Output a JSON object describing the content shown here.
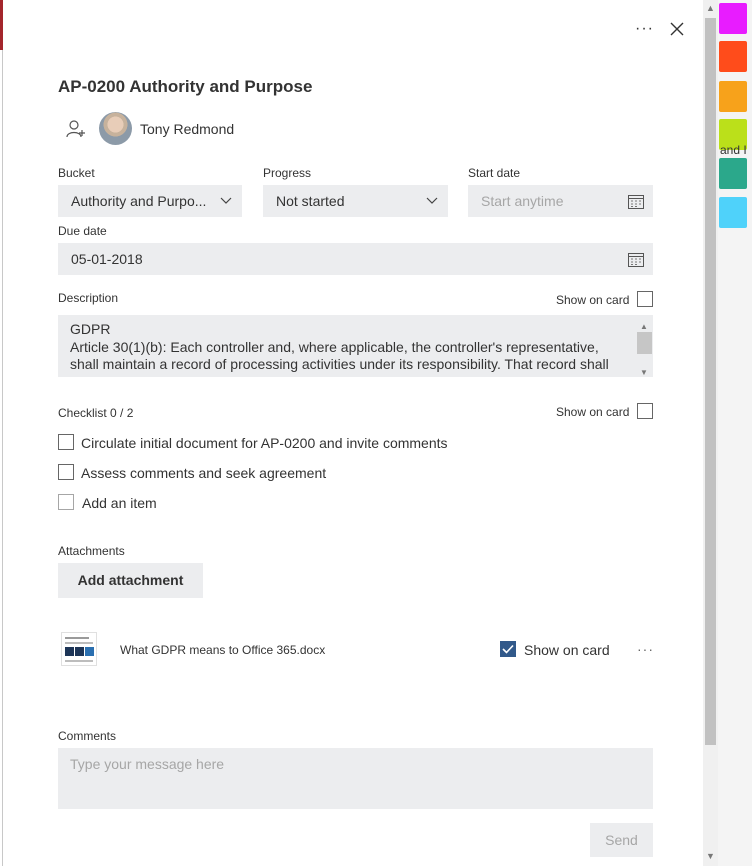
{
  "task": {
    "title": "AP-0200 Authority and Purpose",
    "assignee": "Tony Redmond"
  },
  "fields": {
    "bucket_label": "Bucket",
    "bucket_value": "Authority and Purpo...",
    "progress_label": "Progress",
    "progress_value": "Not started",
    "start_label": "Start date",
    "start_placeholder": "Start anytime",
    "due_label": "Due date",
    "due_value": "05-01-2018"
  },
  "description": {
    "label": "Description",
    "show_on_card": "Show on card",
    "line1": "GDPR",
    "line2": "Article 30(1)(b): Each controller and, where applicable, the controller's representative, shall maintain a record of processing activities under its responsibility. That record shall"
  },
  "checklist": {
    "label": "Checklist 0 / 2",
    "show_on_card": "Show on card",
    "items": [
      "Circulate initial document for AP-0200 and invite comments",
      "Assess comments and seek agreement"
    ],
    "add_placeholder": "Add an item"
  },
  "attachments": {
    "label": "Attachments",
    "add_button": "Add attachment",
    "file_name": "What GDPR means to Office 365.docx",
    "show_on_card": "Show on card",
    "more": "···"
  },
  "comments": {
    "label": "Comments",
    "placeholder": "Type your message here",
    "send": "Send"
  },
  "header": {
    "more": "···"
  },
  "background": {
    "partial_text": "and I"
  },
  "colors": {
    "field_bg": "#ecedef",
    "checkbox_checked": "#31598a",
    "swatches": [
      "#e81cff",
      "#ff4c1b",
      "#f7a21b",
      "#bbe01a",
      "#2ba88b",
      "#4fd2fa"
    ]
  }
}
